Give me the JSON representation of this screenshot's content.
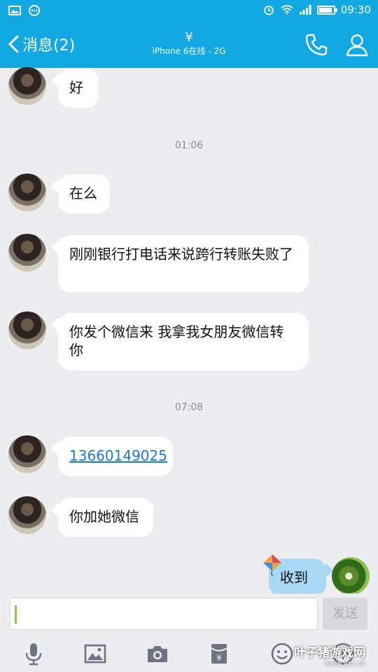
{
  "status_bar": {
    "time": "09:30"
  },
  "header": {
    "back_label": "消息(2)",
    "title": "¥",
    "subtitle": "iPhone 6在线 - 2G"
  },
  "timestamps": [
    "01:06",
    "07:08"
  ],
  "messages": [
    {
      "from": "other",
      "text": "好"
    },
    {
      "from": "other",
      "text": "在么"
    },
    {
      "from": "other",
      "text": "刚刚银行打电话来说跨行转账失败了"
    },
    {
      "from": "other",
      "text": "你发个微信来 我拿我女朋友微信转你"
    },
    {
      "from": "other",
      "text": "13660149025",
      "is_link": true
    },
    {
      "from": "other",
      "text": "你加她微信"
    },
    {
      "from": "me",
      "text": "收到"
    }
  ],
  "composer": {
    "input_value": "",
    "send_label": "发送"
  },
  "toolbar_icons": [
    "microphone-icon",
    "image-icon",
    "camera-icon",
    "red-packet-icon",
    "emoji-icon",
    "plus-icon"
  ],
  "watermark": {
    "main": "叶子猪游戏网",
    "sub": "www.yzz.cn"
  },
  "colors": {
    "accent": "#12a8e2",
    "my_bubble": "#a8d8f4",
    "link": "#1a7ad6"
  }
}
